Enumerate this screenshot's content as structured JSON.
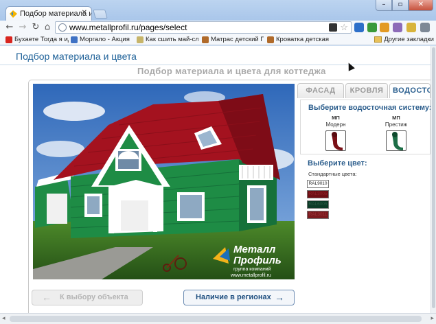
{
  "browser": {
    "tab_title": "Подбор материала и цвет",
    "url": "www.metallprofil.ru/pages/select",
    "bookmarks": [
      "Бухаете Тогда я ид...",
      "Моргало - Акция п...",
      "Как сшить май-сли...",
      "Матрас детский Пл...",
      "Кроватка детская КІ...",
      "Другие закладки"
    ]
  },
  "page": {
    "header_title": "Подбор материала и цвета",
    "subtitle": "Подбор материала и цвета для коттеджа",
    "tabs": [
      "ФАСАД",
      "КРОВЛЯ",
      "ВОДОСТОК"
    ],
    "active_tab": "ВОДОСТОК",
    "gutter_panel": {
      "title": "Выберите водосточная систему:",
      "options": [
        {
          "code": "МП",
          "name": "Модерн"
        },
        {
          "code": "МП",
          "name": "Престиж"
        }
      ]
    },
    "color_panel": {
      "title": "Выберите цвет:",
      "standard_label": "Стандартные цвета:",
      "swatches": [
        {
          "label": "RAL9010",
          "color": "#ffffff",
          "text_color": "#222222"
        },
        {
          "label": "RAL3005",
          "color": "#6e0f14",
          "text_color": "#8e2328"
        },
        {
          "label": "RAL6005",
          "color": "#0d3b27",
          "text_color": "#2a5944"
        },
        {
          "label": "RAL3011",
          "color": "#7c1a1e",
          "text_color": "#9a3539"
        }
      ]
    },
    "buttons": {
      "back": "К выбору объекта",
      "next": "Наличие в регионах"
    },
    "logo": {
      "brand_line1": "Металл",
      "brand_line2": "Профиль",
      "tagline": "группа компаний",
      "site": "www.metallprofil.ru"
    }
  },
  "colors": {
    "roof": "#a4121f",
    "wall": "#1e8c45",
    "trim": "#ffffff",
    "accent_blue": "#2a5f8f"
  }
}
